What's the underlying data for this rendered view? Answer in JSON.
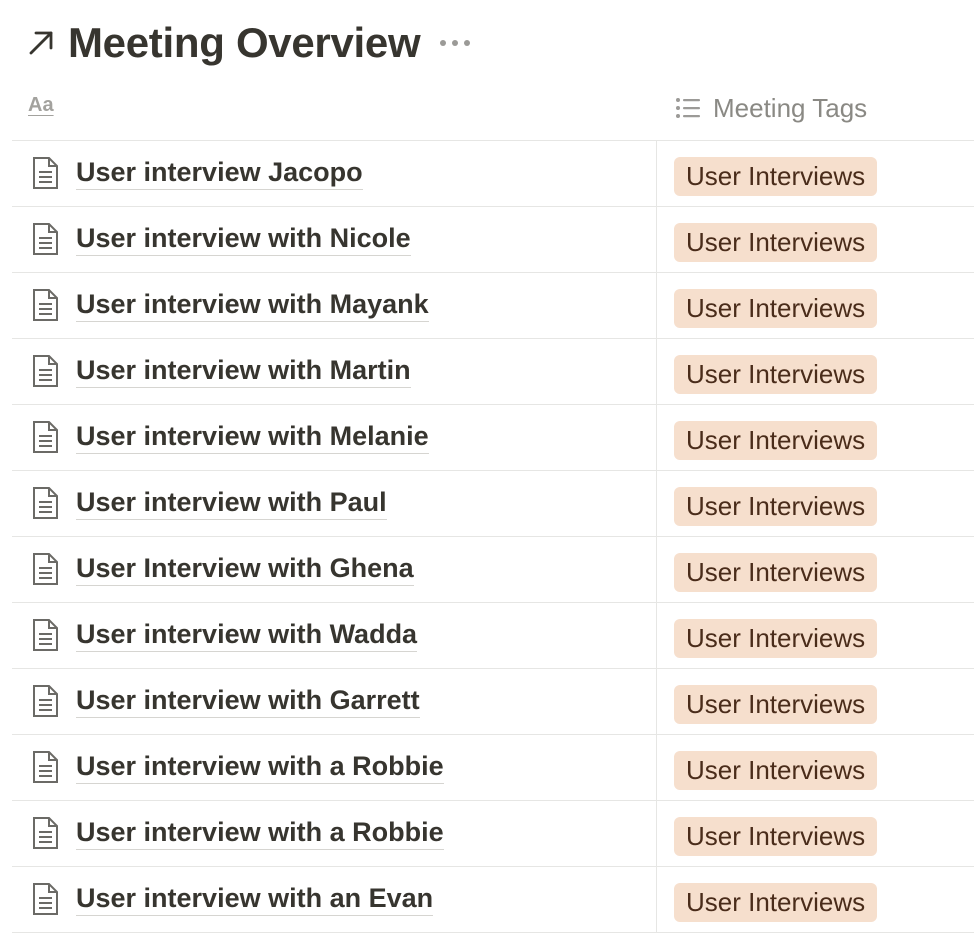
{
  "header": {
    "title": "Meeting Overview",
    "icon": "arrow-up-right-icon",
    "more_icon": "more-horizontal-icon"
  },
  "columns": {
    "name": {
      "label": "Aa"
    },
    "tags": {
      "label": "Meeting Tags",
      "icon": "list-icon"
    }
  },
  "colors": {
    "tag_background": "#f6dfcd",
    "tag_text": "#4a2c1a",
    "text": "#37352f",
    "muted": "#a3a29e",
    "border": "#e6e6e4"
  },
  "rows": [
    {
      "title": "User interview Jacopo",
      "tag": "User Interviews"
    },
    {
      "title": "User interview with Nicole",
      "tag": "User Interviews"
    },
    {
      "title": "User interview with Mayank",
      "tag": "User Interviews"
    },
    {
      "title": "User interview with Martin",
      "tag": "User Interviews"
    },
    {
      "title": "User interview with Melanie",
      "tag": "User Interviews"
    },
    {
      "title": "User interview with Paul",
      "tag": "User Interviews"
    },
    {
      "title": "User Interview with Ghena",
      "tag": "User Interviews"
    },
    {
      "title": "User interview with Wadda",
      "tag": "User Interviews"
    },
    {
      "title": "User interview with Garrett",
      "tag": "User Interviews"
    },
    {
      "title": "User interview with a Robbie",
      "tag": "User Interviews"
    },
    {
      "title": "User interview with a Robbie",
      "tag": "User Interviews"
    },
    {
      "title": "User interview with an Evan",
      "tag": "User Interviews"
    }
  ]
}
